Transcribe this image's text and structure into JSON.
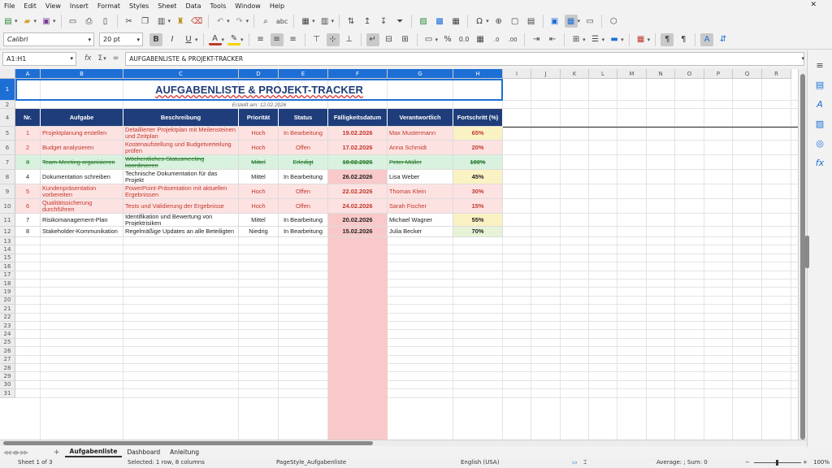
{
  "menu": [
    "File",
    "Edit",
    "View",
    "Insert",
    "Format",
    "Styles",
    "Sheet",
    "Data",
    "Tools",
    "Window",
    "Help"
  ],
  "close_glyph": "✕",
  "toolbar": {
    "font_name": "Calibri",
    "font_size": "20 pt"
  },
  "formula": {
    "name_box": "A1:H1",
    "fx_icon": "fx",
    "sum_icon": "Σ",
    "equals_icon": "=",
    "content": "AUFGABENLISTE & PROJEKT-TRACKER"
  },
  "columns": [
    "A",
    "B",
    "C",
    "D",
    "E",
    "F",
    "G",
    "H",
    "I",
    "J",
    "K",
    "L",
    "M",
    "N",
    "O",
    "P",
    "Q",
    "R"
  ],
  "row_numbers": [
    "1",
    "2",
    "4",
    "5",
    "6",
    "7",
    "8",
    "9",
    "10",
    "11",
    "12",
    "13",
    "14",
    "15",
    "16",
    "17",
    "18",
    "19",
    "20",
    "21",
    "22",
    "23",
    "24",
    "25",
    "26",
    "27",
    "28",
    "29",
    "30",
    "31"
  ],
  "sheet": {
    "title": "AUFGABENLISTE & PROJEKT-TRACKER",
    "subtitle": "Erstellt am: 12.02.2026",
    "headers": [
      "Nr.",
      "Aufgabe",
      "Beschreibung",
      "Priorität",
      "Status",
      "Fälligkeitsdatum",
      "Verantwortlich",
      "Fortschritt (%)"
    ],
    "rows": [
      {
        "nr": "1",
        "task": "Projektplanung erstellen",
        "desc": "Detaillierter Projektplan mit Meilensteinen und Zeitplan",
        "prio": "Hoch",
        "status": "In Bearbeitung",
        "due": "19.02.2026",
        "owner": "Max Mustermann",
        "progress": "65%"
      },
      {
        "nr": "2",
        "task": "Budget analysieren",
        "desc": "Kostenaufstellung und Budgetverteilung prüfen",
        "prio": "Hoch",
        "status": "Offen",
        "due": "17.02.2026",
        "owner": "Anna Schmidt",
        "progress": "20%"
      },
      {
        "nr": "3",
        "task": "Team-Meeting organisieren",
        "desc": "Wöchentliches Statusmeeting koordinieren",
        "prio": "Mittel",
        "status": "Erledigt",
        "due": "10.02.2026",
        "owner": "Peter Müller",
        "progress": "100%"
      },
      {
        "nr": "4",
        "task": "Dokumentation schreiben",
        "desc": "Technische Dokumentation für das Projekt",
        "prio": "Mittel",
        "status": "In Bearbeitung",
        "due": "26.02.2026",
        "owner": "Lisa Weber",
        "progress": "45%"
      },
      {
        "nr": "5",
        "task": "Kundenpräsentation vorbereiten",
        "desc": "PowerPoint-Präsentation mit aktuellen Ergebnissen",
        "prio": "Hoch",
        "status": "Offen",
        "due": "22.02.2026",
        "owner": "Thomas Klein",
        "progress": "30%"
      },
      {
        "nr": "6",
        "task": "Qualitätssicherung durchführen",
        "desc": "Tests und Validierung der Ergebnisse",
        "prio": "Hoch",
        "status": "Offen",
        "due": "24.02.2026",
        "owner": "Sarah Fischer",
        "progress": "15%"
      },
      {
        "nr": "7",
        "task": "Risikomanagement-Plan",
        "desc": "Identifikation und Bewertung von Projektrisiken",
        "prio": "Mittel",
        "status": "In Bearbeitung",
        "due": "20.02.2026",
        "owner": "Michael Wagner",
        "progress": "55%"
      },
      {
        "nr": "8",
        "task": "Stakeholder-Kommunikation",
        "desc": "Regelmäßige Updates an alle Beteiligten",
        "prio": "Niedrig",
        "status": "In Bearbeitung",
        "due": "15.02.2026",
        "owner": "Julia Becker",
        "progress": "70%"
      }
    ]
  },
  "colors": {
    "header_bg": "#1f3d7a",
    "high_row_bg": "#fde2e2",
    "done_row_bg": "#d9f2df",
    "due_highlight_bg": "#f9c9c9",
    "selection": "#1d6fd6"
  },
  "tabs": {
    "add": "+",
    "items": [
      "Aufgabenliste",
      "Dashboard",
      "Anleitung"
    ],
    "active": "Aufgabenliste"
  },
  "status": {
    "sheet": "Sheet 1 of 3",
    "selection": "Selected: 1 row, 8 columns",
    "page_style": "PageStyle_Aufgabenliste",
    "language": "English (USA)",
    "summary": "Average: ; Sum: 0",
    "zoom": "100%"
  }
}
